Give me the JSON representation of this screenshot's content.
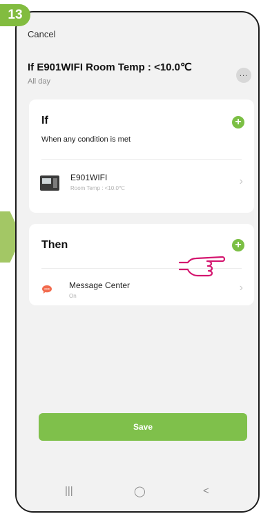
{
  "step_badge": "13",
  "header": {
    "cancel_label": "Cancel",
    "title": "If E901WIFI Room Temp : <10.0℃",
    "subtitle": "All day",
    "more_label": "..."
  },
  "if_card": {
    "title": "If",
    "description": "When any condition is met",
    "add_label": "+",
    "condition": {
      "device": "E901WIFI",
      "detail": "Room Temp : <10.0℃",
      "icon": "device-thermostat-icon"
    }
  },
  "then_card": {
    "title": "Then",
    "add_label": "+",
    "action": {
      "name": "Message Center",
      "state": "On",
      "icon": "message-bubble-icon"
    }
  },
  "save_label": "Save",
  "nav": {
    "recent": "|||",
    "home": "◯",
    "back": "<"
  },
  "colors": {
    "accent_green": "#7fc04b",
    "message_icon": "#f26b4e",
    "pointer_hand": "#d4166f"
  }
}
